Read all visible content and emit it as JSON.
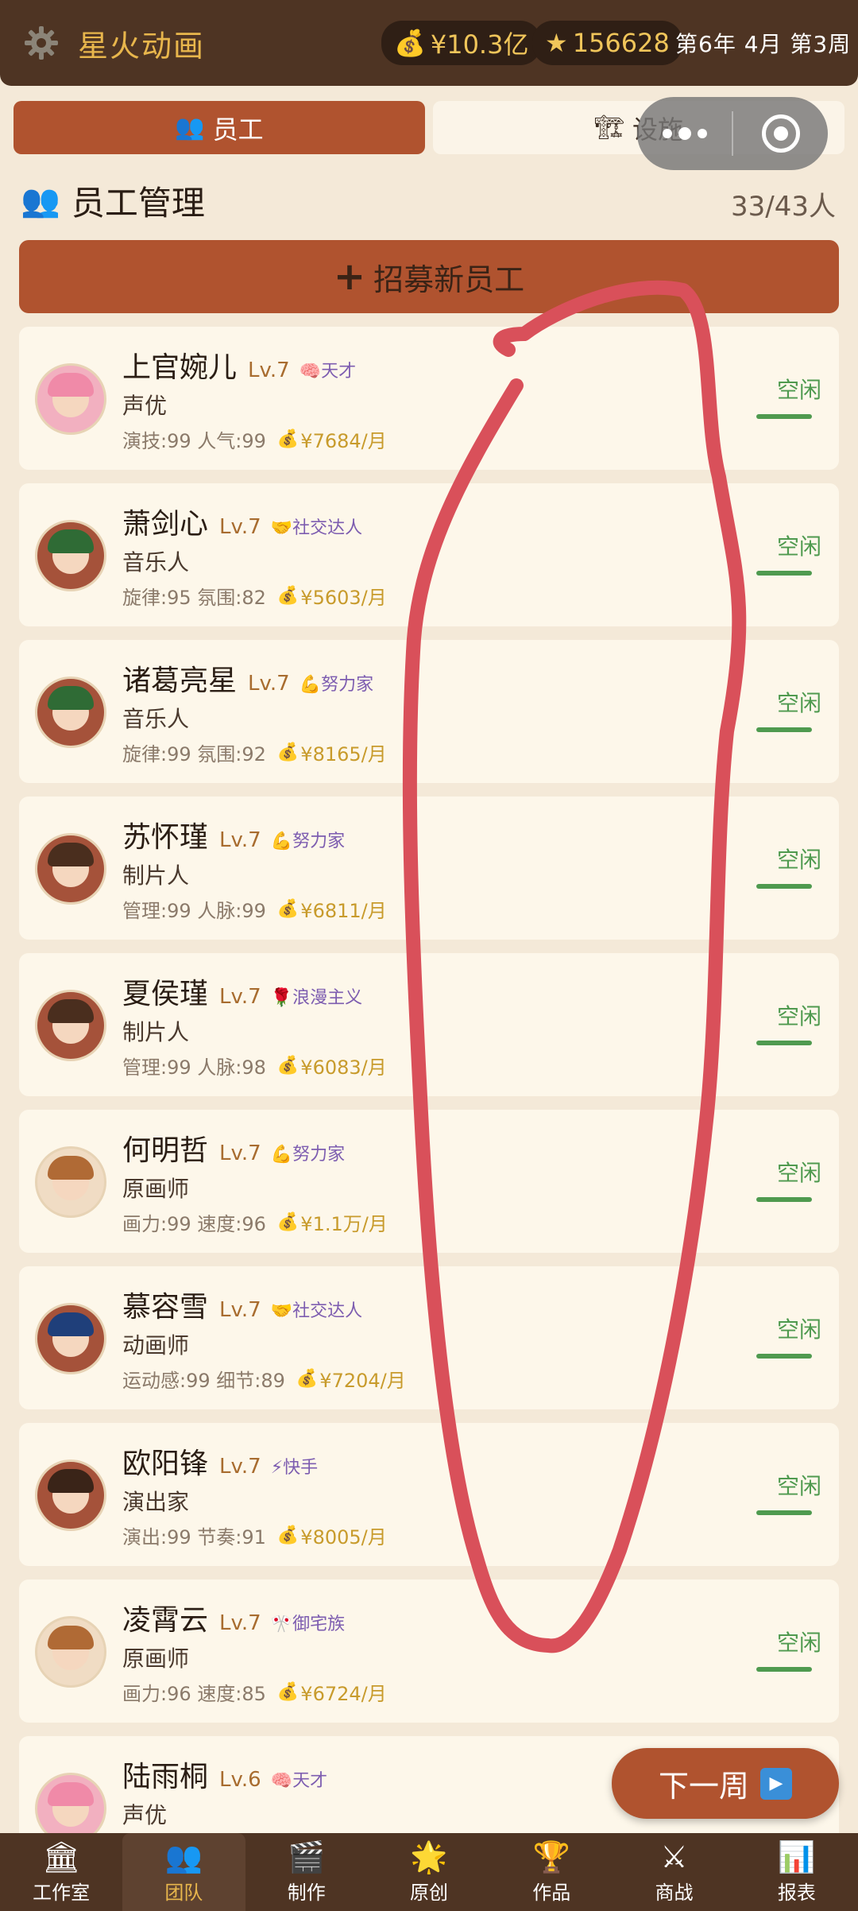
{
  "app": {
    "title": "星火动画",
    "money": "¥10.3亿",
    "money_icon": "money-bag-icon",
    "stars": "156628",
    "date": "第6年 4月 第3周"
  },
  "tabs": [
    {
      "label": "员工",
      "icon": "people-icon",
      "active": true
    },
    {
      "label": "设施",
      "icon": "crane-icon",
      "active": false
    }
  ],
  "section": {
    "title": "员工管理",
    "count": "33/43人",
    "recruit_label": "招募新员工"
  },
  "employees": [
    {
      "name": "上官婉儿",
      "level": "Lv.7",
      "trait_icon": "🧠",
      "trait": "天才",
      "role": "声优",
      "stats": "演技:99 人气:99",
      "salary": "¥7684/月",
      "status": "空闲",
      "avatar_color": "#f2b0c0",
      "hair": "#f08aa8"
    },
    {
      "name": "萧剑心",
      "level": "Lv.7",
      "trait_icon": "🤝",
      "trait": "社交达人",
      "role": "音乐人",
      "stats": "旋律:95 氛围:82",
      "salary": "¥5603/月",
      "status": "空闲",
      "avatar_color": "#a5523a",
      "hair": "#2f6b35"
    },
    {
      "name": "诸葛亮星",
      "level": "Lv.7",
      "trait_icon": "💪",
      "trait": "努力家",
      "role": "音乐人",
      "stats": "旋律:99 氛围:92",
      "salary": "¥8165/月",
      "status": "空闲",
      "avatar_color": "#a5523a",
      "hair": "#2f6b35"
    },
    {
      "name": "苏怀瑾",
      "level": "Lv.7",
      "trait_icon": "💪",
      "trait": "努力家",
      "role": "制片人",
      "stats": "管理:99 人脉:99",
      "salary": "¥6811/月",
      "status": "空闲",
      "avatar_color": "#a5523a",
      "hair": "#4a2e1e"
    },
    {
      "name": "夏侯瑾",
      "level": "Lv.7",
      "trait_icon": "🌹",
      "trait": "浪漫主义",
      "role": "制片人",
      "stats": "管理:99 人脉:98",
      "salary": "¥6083/月",
      "status": "空闲",
      "avatar_color": "#a5523a",
      "hair": "#4a2e1e"
    },
    {
      "name": "何明哲",
      "level": "Lv.7",
      "trait_icon": "💪",
      "trait": "努力家",
      "role": "原画师",
      "stats": "画力:99 速度:96",
      "salary": "¥1.1万/月",
      "status": "空闲",
      "avatar_color": "#f0dcc4",
      "hair": "#b06a35"
    },
    {
      "name": "慕容雪",
      "level": "Lv.7",
      "trait_icon": "🤝",
      "trait": "社交达人",
      "role": "动画师",
      "stats": "运动感:99 细节:89",
      "salary": "¥7204/月",
      "status": "空闲",
      "avatar_color": "#a5523a",
      "hair": "#1f3f7a"
    },
    {
      "name": "欧阳锋",
      "level": "Lv.7",
      "trait_icon": "⚡",
      "trait": "快手",
      "role": "演出家",
      "stats": "演出:99 节奏:91",
      "salary": "¥8005/月",
      "status": "空闲",
      "avatar_color": "#a5523a",
      "hair": "#3a2418"
    },
    {
      "name": "凌霄云",
      "level": "Lv.7",
      "trait_icon": "🎌",
      "trait": "御宅族",
      "role": "原画师",
      "stats": "画力:96 速度:85",
      "salary": "¥6724/月",
      "status": "空闲",
      "avatar_color": "#f0dcc4",
      "hair": "#b06a35"
    },
    {
      "name": "陆雨桐",
      "level": "Lv.6",
      "trait_icon": "🧠",
      "trait": "天才",
      "role": "声优",
      "stats": "",
      "salary": "",
      "status": "",
      "avatar_color": "#f2b0c0",
      "hair": "#f08aa8"
    }
  ],
  "next_week": {
    "label": "下一周",
    "icon": "play-icon"
  },
  "bottom_nav": [
    {
      "label": "工作室",
      "icon": "building-icon",
      "glyph": "🏛",
      "active": false
    },
    {
      "label": "团队",
      "icon": "team-icon",
      "glyph": "👥",
      "active": true
    },
    {
      "label": "制作",
      "icon": "clapper-icon",
      "glyph": "🎬",
      "active": false
    },
    {
      "label": "原创",
      "icon": "spark-icon",
      "glyph": "🌟",
      "active": false
    },
    {
      "label": "作品",
      "icon": "trophy-icon",
      "glyph": "🏆",
      "active": false
    },
    {
      "label": "商战",
      "icon": "swords-icon",
      "glyph": "⚔",
      "active": false
    },
    {
      "label": "报表",
      "icon": "chart-icon",
      "glyph": "📊",
      "active": false
    }
  ],
  "colors": {
    "accent": "#b0532f",
    "topbar": "#4e3423",
    "gold": "#e8b64c",
    "idle_green": "#4f9a4f",
    "annotation": "#d9505a"
  }
}
